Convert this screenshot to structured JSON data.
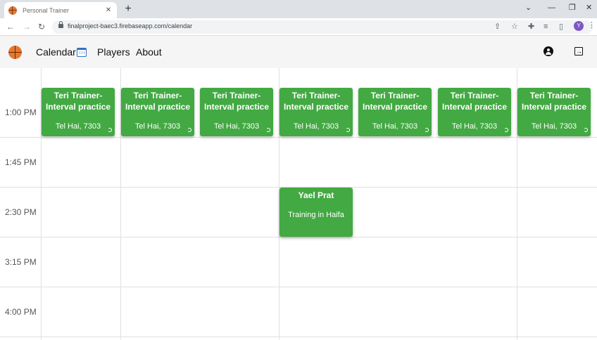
{
  "browser": {
    "tab": {
      "title": "Personal Trainer",
      "close": "✕"
    },
    "new_tab": "+",
    "window_controls": {
      "minimize": "—",
      "restore": "❐",
      "close": "✕",
      "tab_search": "⌄"
    },
    "nav": {
      "back": "←",
      "forward": "→",
      "reload": "↻"
    },
    "url": "finalproject-baec3.firebaseapp.com/calendar",
    "profile_initial": "Y",
    "menu": "⋮"
  },
  "appbar": {
    "links": {
      "calendar": "Calendar",
      "players": "Players",
      "about": "About"
    },
    "logout_glyph": "→"
  },
  "calendar": {
    "time_slots": [
      "1:00 PM",
      "1:45 PM",
      "2:30 PM",
      "3:15 PM",
      "4:00 PM"
    ],
    "day_columns": 7,
    "recurring_event": {
      "title": "Teri Trainer-Interval practice",
      "location": "Tel Hai, 7303",
      "recurring": true,
      "slot": "1:00 PM",
      "days": [
        0,
        1,
        2,
        3,
        4,
        5,
        6
      ]
    },
    "events": [
      {
        "title": "Yael Prat",
        "location": "Training in Haifa",
        "slot": "2:30 PM",
        "day": 3
      }
    ]
  },
  "colors": {
    "event_green": "#43a943",
    "appbar_bg": "#f5f5f5",
    "calendar_icon": "#2f72c7"
  }
}
